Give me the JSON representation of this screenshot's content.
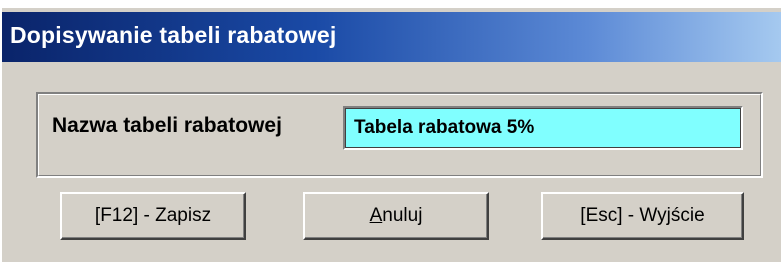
{
  "window": {
    "title": "Dopisywanie tabeli rabatowej"
  },
  "form": {
    "name_label": "Nazwa tabeli rabatowej",
    "name_value": "Tabela rabatowa 5%"
  },
  "buttons": {
    "save_label": "[F12] - Zapisz",
    "cancel_accesskey": "A",
    "cancel_rest": "nuluj",
    "exit_label": "[Esc] - Wyjście"
  },
  "colors": {
    "title_gradient_start": "#0a246a",
    "title_gradient_end": "#a6caf0",
    "input_background": "#80ffff",
    "window_background": "#d4d0c8"
  }
}
